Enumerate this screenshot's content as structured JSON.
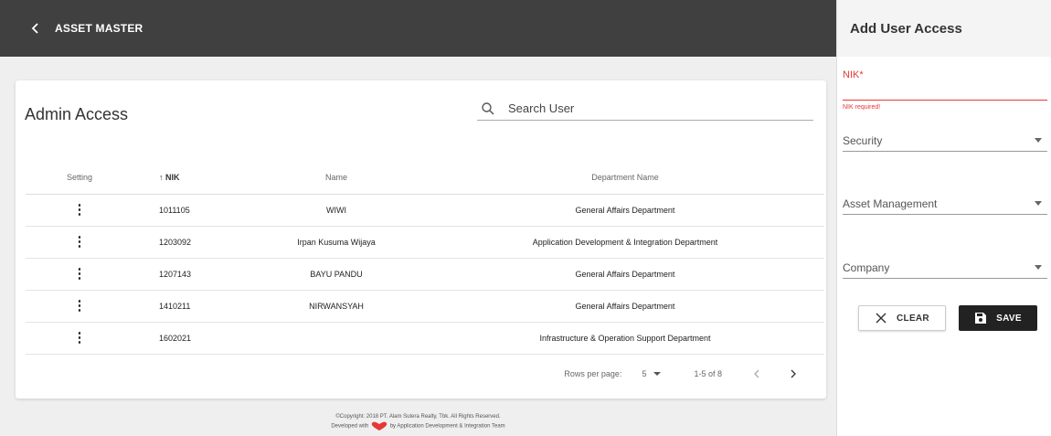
{
  "header": {
    "title": "ASSET MASTER",
    "back_icon": "chevron-left-icon"
  },
  "card": {
    "title": "Admin Access",
    "search": {
      "placeholder": "Search User",
      "icon": "search-icon"
    }
  },
  "table": {
    "columns": {
      "setting": "Setting",
      "nik": "↑ NIK",
      "name": "Name",
      "department": "Department Name"
    },
    "rows": [
      {
        "nik": "1011105",
        "name": "WIWI",
        "department": "General Affairs Department"
      },
      {
        "nik": "1203092",
        "name": "Irpan Kusuma Wijaya",
        "department": "Application Development & Integration Department"
      },
      {
        "nik": "1207143",
        "name": "BAYU PANDU",
        "department": "General Affairs Department"
      },
      {
        "nik": "1410211",
        "name": "NIRWANSYAH",
        "department": "General Affairs Department"
      },
      {
        "nik": "1602021",
        "name": "",
        "department": "Infrastructure & Operation Support Department"
      }
    ],
    "kebab": "⋮"
  },
  "pagination": {
    "rows_per_page_label": "Rows per page:",
    "rows_per_page": "5",
    "range": "1-5 of 8"
  },
  "footer": {
    "copyright": "©Copyright: 2018 PT. Alam Sutera Realty, Tbk. All Rights Reserved.",
    "developed_prefix": "Developed with",
    "developed_suffix": "by Application Development & Integration Team"
  },
  "panel": {
    "title": "Add User Access",
    "nik_label": "NIK*",
    "nik_value": "",
    "nik_error": "NIK required!",
    "selects": {
      "security": "Security",
      "asset_management": "Asset Management",
      "company": "Company"
    },
    "clear_label": "CLEAR",
    "save_label": "SAVE"
  },
  "colors": {
    "error": "#e53935",
    "topbar": "#404040",
    "save_button": "#222222",
    "heart": "#e53935"
  }
}
